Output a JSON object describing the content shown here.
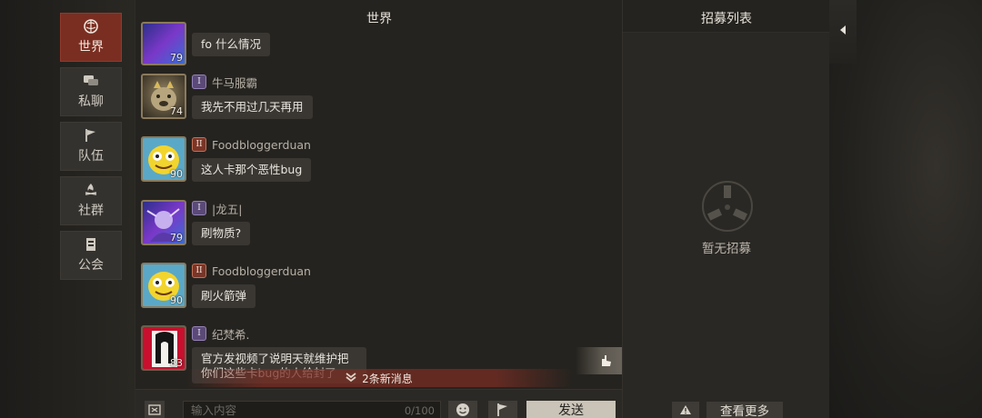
{
  "nav": {
    "items": [
      {
        "label": "世界",
        "icon": "globe-icon",
        "active": true
      },
      {
        "label": "私聊",
        "icon": "chat-bubbles-icon"
      },
      {
        "label": "队伍",
        "icon": "flag-icon"
      },
      {
        "label": "社群",
        "icon": "campfire-icon"
      },
      {
        "label": "公会",
        "icon": "guild-banner-icon"
      }
    ]
  },
  "chat": {
    "title": "世界",
    "messages": [
      {
        "name": "",
        "level": "79",
        "text": "fo  什么情况"
      },
      {
        "name": "牛马服霸",
        "level": "74",
        "rank": "I",
        "text": "我先不用过几天再用"
      },
      {
        "name": "Foodbloggerduan",
        "level": "90",
        "rank": "II",
        "text": "这人卡那个恶性bug"
      },
      {
        "name": "|龙五|",
        "level": "79",
        "rank": "I",
        "text": "刷物质?"
      },
      {
        "name": "Foodbloggerduan",
        "level": "90",
        "rank": "II",
        "text": "刷火箭弹"
      },
      {
        "name": "纪梵希.",
        "level": "83",
        "rank": "I",
        "text": "官方发视频了说明天就维护把你们这些卡bug的人给封了"
      }
    ],
    "new_messages_label": "2条新消息",
    "input_placeholder": "输入内容",
    "char_count": "0/100",
    "send_label": "发送"
  },
  "recruit": {
    "title": "招募列表",
    "empty_text": "暂无招募",
    "view_more_label": "查看更多"
  },
  "colors": {
    "accent_active": "#7a2e22",
    "panel_bg": "#25231f",
    "bubble_bg": "#3a3733",
    "rank_i": "#5b4a78",
    "rank_ii": "#7a3527"
  }
}
